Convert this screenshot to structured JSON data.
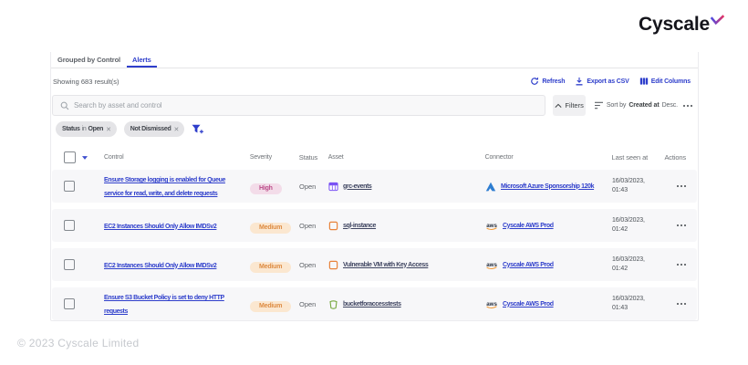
{
  "brand": {
    "name": "Cyscale"
  },
  "tabs": {
    "grouped": "Grouped by Control",
    "alerts": "Alerts"
  },
  "results_summary": "Showing 683 result(s)",
  "toolbar": {
    "refresh": "Refresh",
    "export_csv": "Export as CSV",
    "edit_columns": "Edit Columns"
  },
  "search": {
    "placeholder": "Search by asset and control"
  },
  "filters_button": "Filters",
  "sort": {
    "prefix": "Sort by",
    "field": "Created at",
    "direction": "Desc."
  },
  "filter_chips": [
    {
      "segments": [
        {
          "text": "Status",
          "strong": true
        },
        {
          "text": "in",
          "strong": false
        },
        {
          "text": "Open",
          "strong": true
        }
      ]
    },
    {
      "segments": [
        {
          "text": "Not Dismissed",
          "strong": true
        }
      ]
    }
  ],
  "table": {
    "headers": {
      "control": "Control",
      "severity": "Severity",
      "status": "Status",
      "asset": "Asset",
      "connector": "Connector",
      "last_seen": "Last seen at",
      "actions": "Actions"
    },
    "rows": [
      {
        "control": "Ensure Storage logging is enabled for Queue\nservice for read, write, and delete requests",
        "severity": "High",
        "status": "Open",
        "asset": {
          "name": "grc-events",
          "icon": "table-icon"
        },
        "connector": {
          "name": "Microsoft Azure Sponsorship 120k",
          "icon": "azure-icon"
        },
        "last_seen": "16/03/2023,\n01:43"
      },
      {
        "control": "EC2 Instances Should Only Allow IMDSv2",
        "severity": "Medium",
        "status": "Open",
        "asset": {
          "name": "sql-instance",
          "icon": "vm-icon"
        },
        "connector": {
          "name": "Cyscale AWS Prod",
          "icon": "aws-icon"
        },
        "last_seen": "16/03/2023,\n01:42"
      },
      {
        "control": "EC2 Instances Should Only Allow IMDSv2",
        "severity": "Medium",
        "status": "Open",
        "asset": {
          "name": "Vulnerable VM with Key Access",
          "icon": "vm-icon"
        },
        "connector": {
          "name": "Cyscale AWS Prod",
          "icon": "aws-icon"
        },
        "last_seen": "16/03/2023,\n01:42"
      },
      {
        "control": "Ensure S3 Bucket Policy is set to deny HTTP\nrequests",
        "severity": "Medium",
        "status": "Open",
        "asset": {
          "name": "bucketforaccesstests",
          "icon": "bucket-icon"
        },
        "connector": {
          "name": "Cyscale AWS Prod",
          "icon": "aws-icon"
        },
        "last_seen": "16/03/2023,\n01:43"
      }
    ]
  },
  "severity_styles": {
    "High": {
      "bg": "#f3dce9",
      "text": "#bb4b89"
    },
    "Medium": {
      "bg": "#fbe7d0",
      "text": "#dd8b42"
    }
  },
  "footer": "© 2023 Cyscale Limited",
  "colors": {
    "accent": "#2e3ecb"
  }
}
